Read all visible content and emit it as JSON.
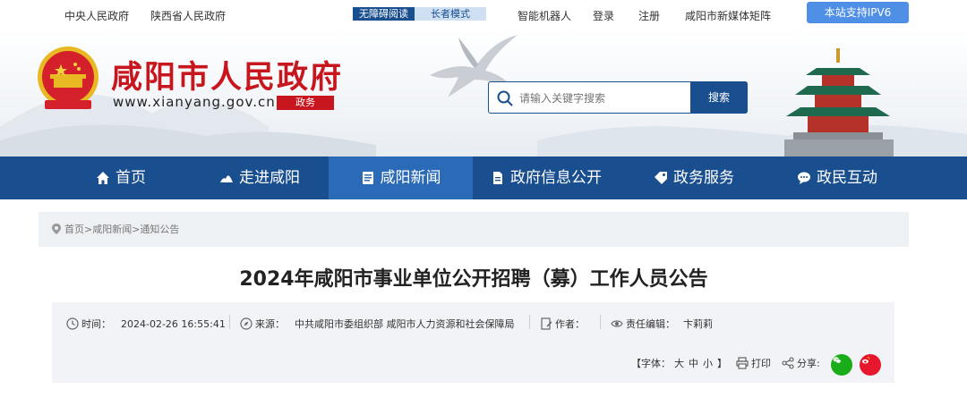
{
  "topbar": {
    "link1": "中央人民政府",
    "link2": "陕西省人民政府",
    "accessible": "无障碍阅读",
    "elder": "长者模式",
    "robot": "智能机器人",
    "login": "登录",
    "register": "注册",
    "media": "咸阳市新媒体矩阵",
    "ipv6": "本站支持IPV6"
  },
  "header": {
    "site_name": "咸阳市人民政府",
    "site_url": "www.xianyang.gov.cn",
    "tag": "政务",
    "search_placeholder": "请输入关键字搜索",
    "search_button": "搜索"
  },
  "nav": {
    "items": [
      "首页",
      "走进咸阳",
      "咸阳新闻",
      "政府信息公开",
      "政务服务",
      "政民互动"
    ],
    "active_index": 2
  },
  "breadcrumb": "首页>咸阳新闻>通知公告",
  "article": {
    "title": "2024年咸阳市事业单位公开招聘（募）工作人员公告",
    "time_label": "时间：",
    "time": "2024-02-26 16:55:41",
    "source_label": "来源：",
    "source": "中共咸阳市委组织部 咸阳市人力资源和社会保障局",
    "author_label": "作者：",
    "author": "",
    "editor_label": "责任编辑：",
    "editor": "卞莉莉",
    "font_label": "【字体：",
    "font_large": "大",
    "font_mid": "中",
    "font_small": "小",
    "font_close": "】",
    "print": "打印",
    "share": "分享:"
  },
  "colors": {
    "brand_blue": "#1a4f8f",
    "active_blue": "#2a6ab7",
    "brand_red": "#c8161e",
    "wechat_green": "#1aad19",
    "weibo_red": "#e6162d"
  }
}
